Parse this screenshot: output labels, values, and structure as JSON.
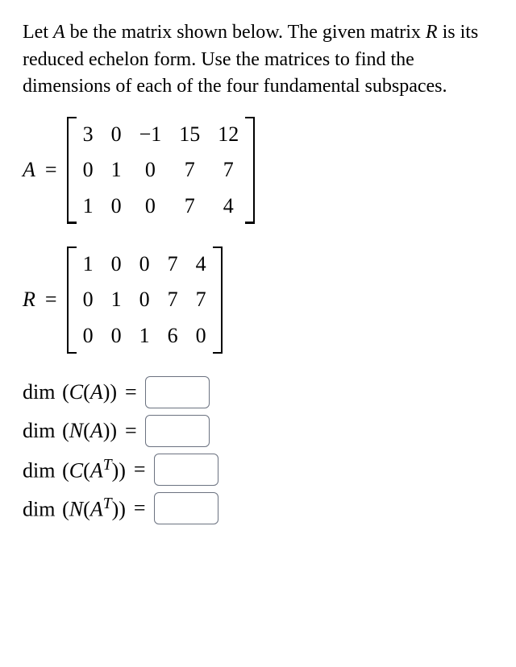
{
  "prompt": {
    "text_parts": [
      "Let ",
      "A",
      " be the matrix shown below. The given matrix ",
      "R",
      " is its reduced echelon form. Use the matrices to find the dimensions of each of the four fundamental subspaces."
    ]
  },
  "matrix_A": {
    "label": "A",
    "equals": "=",
    "rows": [
      [
        "3",
        "0",
        "−1",
        "15",
        "12"
      ],
      [
        "0",
        "1",
        "0",
        "7",
        "7"
      ],
      [
        "1",
        "0",
        "0",
        "7",
        "4"
      ]
    ]
  },
  "matrix_R": {
    "label": "R",
    "equals": "=",
    "rows": [
      [
        "1",
        "0",
        "0",
        "7",
        "4"
      ],
      [
        "0",
        "1",
        "0",
        "7",
        "7"
      ],
      [
        "0",
        "0",
        "1",
        "6",
        "0"
      ]
    ]
  },
  "answers": [
    {
      "prefix": "dim",
      "open": "(",
      "fn": "C",
      "inner_open": "(",
      "var": "A",
      "sup": "",
      "inner_close": ")",
      "close": ")",
      "eq": "=",
      "value": ""
    },
    {
      "prefix": "dim",
      "open": "(",
      "fn": "N",
      "inner_open": "(",
      "var": "A",
      "sup": "",
      "inner_close": ")",
      "close": ")",
      "eq": "=",
      "value": ""
    },
    {
      "prefix": "dim",
      "open": "(",
      "fn": "C",
      "inner_open": "(",
      "var": "A",
      "sup": "T",
      "inner_close": ")",
      "close": ")",
      "eq": "=",
      "value": ""
    },
    {
      "prefix": "dim",
      "open": "(",
      "fn": "N",
      "inner_open": "(",
      "var": "A",
      "sup": "T",
      "inner_close": ")",
      "close": ")",
      "eq": "=",
      "value": ""
    }
  ]
}
